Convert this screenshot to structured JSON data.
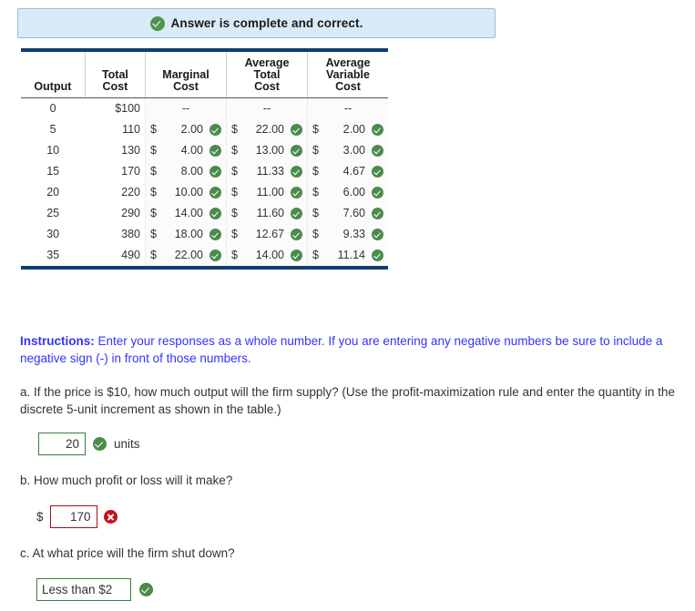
{
  "banner": {
    "icon": "check-circle-icon",
    "text": "Answer is complete and correct."
  },
  "table": {
    "headers": [
      "Output",
      "Total\nCost",
      "Marginal\nCost",
      "Average\nTotal\nCost",
      "Average\nVariable\nCost"
    ],
    "headers_flat": {
      "output": "Output",
      "total_cost_l1": "Total",
      "total_cost_l2": "Cost",
      "marginal_cost_l1": "Marginal",
      "marginal_cost_l2": "Cost",
      "avg_total_cost_l1": "Average",
      "avg_total_cost_l2": "Total",
      "avg_total_cost_l3": "Cost",
      "avg_var_cost_l1": "Average",
      "avg_var_cost_l2": "Variable",
      "avg_var_cost_l3": "Cost"
    },
    "dash": "--",
    "currency": "$",
    "rows": [
      {
        "output": "0",
        "total_cost": "$100",
        "mc": "--",
        "mc_status": "none",
        "atc": "--",
        "atc_status": "none",
        "avc": "--",
        "avc_status": "none"
      },
      {
        "output": "5",
        "total_cost": "110",
        "mc": "2.00",
        "mc_status": "correct",
        "atc": "22.00",
        "atc_status": "correct",
        "avc": "2.00",
        "avc_status": "correct"
      },
      {
        "output": "10",
        "total_cost": "130",
        "mc": "4.00",
        "mc_status": "correct",
        "atc": "13.00",
        "atc_status": "correct",
        "avc": "3.00",
        "avc_status": "correct"
      },
      {
        "output": "15",
        "total_cost": "170",
        "mc": "8.00",
        "mc_status": "correct",
        "atc": "11.33",
        "atc_status": "correct",
        "avc": "4.67",
        "avc_status": "correct"
      },
      {
        "output": "20",
        "total_cost": "220",
        "mc": "10.00",
        "mc_status": "correct",
        "atc": "11.00",
        "atc_status": "correct",
        "avc": "6.00",
        "avc_status": "correct"
      },
      {
        "output": "25",
        "total_cost": "290",
        "mc": "14.00",
        "mc_status": "correct",
        "atc": "11.60",
        "atc_status": "correct",
        "avc": "7.60",
        "avc_status": "correct"
      },
      {
        "output": "30",
        "total_cost": "380",
        "mc": "18.00",
        "mc_status": "correct",
        "atc": "12.67",
        "atc_status": "correct",
        "avc": "9.33",
        "avc_status": "correct"
      },
      {
        "output": "35",
        "total_cost": "490",
        "mc": "22.00",
        "mc_status": "correct",
        "atc": "14.00",
        "atc_status": "correct",
        "avc": "11.14",
        "avc_status": "correct"
      }
    ]
  },
  "instructions": {
    "label": "Instructions:",
    "text": " Enter your responses as a whole number. If you are entering any negative numbers be sure to include a negative sign (-) in front of those numbers."
  },
  "questions": {
    "a": {
      "prompt": "a. If the price is $10, how much output will the firm supply? (Use the profit-maximization rule and enter the quantity in the discrete 5-unit increment as shown in the table.)",
      "value": "20",
      "unit": "units",
      "status": "correct",
      "status_icon": "check-circle-icon"
    },
    "b": {
      "prompt": "b. How much profit or loss will it make?",
      "prefix": "$",
      "value": "170",
      "status": "incorrect",
      "status_icon": "x-circle-icon"
    },
    "c": {
      "prompt": "c. At what price will the firm shut down?",
      "value": "Less than $2",
      "status": "correct",
      "status_icon": "check-circle-icon"
    }
  },
  "colors": {
    "banner_bg": "#d9ebf9",
    "banner_border": "#92c0e0",
    "table_rule": "#0f3d70",
    "correct_green": "#4b8b4b",
    "incorrect_red": "#c1121c",
    "instruction_blue": "#3333ff",
    "input_green_border": "#3f7d3f",
    "input_red_border": "#a01118"
  }
}
